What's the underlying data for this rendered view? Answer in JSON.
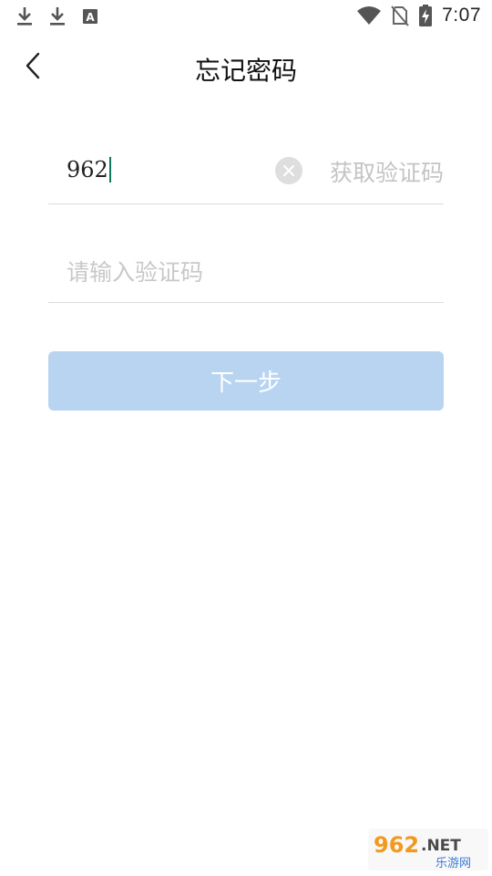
{
  "status_bar": {
    "time": "7:07",
    "icons": [
      "download-icon",
      "download-icon",
      "font-a-icon",
      "wifi-icon",
      "no-sim-icon",
      "battery-charging-icon"
    ],
    "font_icon_letter": "A"
  },
  "header": {
    "title": "忘记密码",
    "back_icon": "chevron-left-icon"
  },
  "form": {
    "phone_value": "962",
    "clear_icon": "close-circle-icon",
    "get_code_label": "获取验证码",
    "code_placeholder": "请输入验证码",
    "code_value": ""
  },
  "next_button": {
    "label": "下一步"
  },
  "watermark": {
    "brand": "962.NET",
    "subtitle": "乐游网"
  },
  "colors": {
    "accent_button": "#b8d4f1",
    "caret": "#0d7a5f",
    "placeholder": "#c8c8c8",
    "divider": "#dcdcdc"
  }
}
